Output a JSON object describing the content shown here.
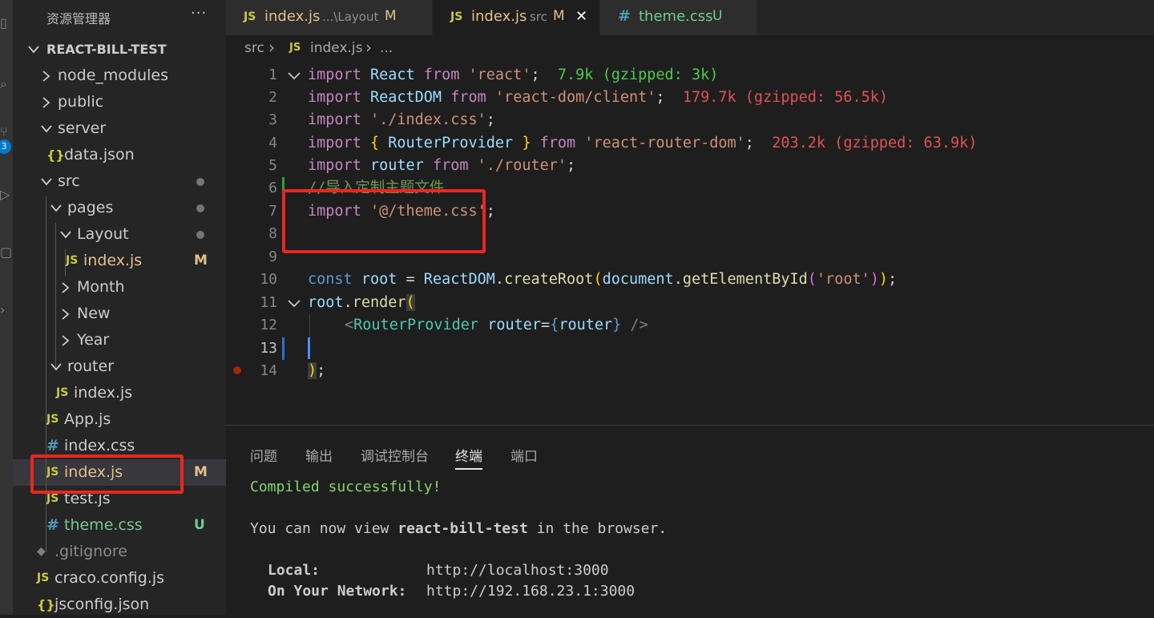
{
  "explorer": {
    "title": "资源管理器",
    "more": "···",
    "project": "REACT-BILL-TEST",
    "items": [
      {
        "label": "node_modules",
        "kind": "folder",
        "status": ""
      },
      {
        "label": "public",
        "kind": "folder",
        "status": ""
      },
      {
        "label": "server",
        "kind": "folder",
        "status": ""
      },
      {
        "label": "data.json",
        "kind": "json",
        "status": ""
      },
      {
        "label": "src",
        "kind": "folder",
        "status": "dot"
      },
      {
        "label": "pages",
        "kind": "folder",
        "status": "dot"
      },
      {
        "label": "Layout",
        "kind": "folder",
        "status": "dot"
      },
      {
        "label": "index.js",
        "kind": "js",
        "status": "M"
      },
      {
        "label": "Month",
        "kind": "folder",
        "status": ""
      },
      {
        "label": "New",
        "kind": "folder",
        "status": ""
      },
      {
        "label": "Year",
        "kind": "folder",
        "status": ""
      },
      {
        "label": "router",
        "kind": "folder",
        "status": ""
      },
      {
        "label": "index.js",
        "kind": "js",
        "status": ""
      },
      {
        "label": "App.js",
        "kind": "js",
        "status": ""
      },
      {
        "label": "index.css",
        "kind": "css",
        "status": ""
      },
      {
        "label": "index.js",
        "kind": "js",
        "status": "M"
      },
      {
        "label": "test.js",
        "kind": "js",
        "status": ""
      },
      {
        "label": "theme.css",
        "kind": "css",
        "status": "U"
      },
      {
        "label": ".gitignore",
        "kind": "git",
        "status": ""
      },
      {
        "label": "craco.config.js",
        "kind": "js",
        "status": ""
      },
      {
        "label": "jsconfig.json",
        "kind": "json",
        "status": ""
      }
    ]
  },
  "icons": {
    "js": "JS",
    "css": "#",
    "json": "{}",
    "git": "◆"
  },
  "activity": {
    "badge": "3"
  },
  "tabs": [
    {
      "icon": "JS",
      "name": "index.js",
      "desc": "...\\Layout",
      "status": "M"
    },
    {
      "icon": "JS",
      "name": "index.js",
      "desc": "src",
      "status": "M",
      "close": "✕"
    },
    {
      "icon": "#",
      "name": "theme.css",
      "desc": "",
      "status": "U"
    }
  ],
  "breadcrumb": {
    "part1": "src",
    "sep1": "›",
    "icon": "JS",
    "part2": "index.js",
    "sep2": "›",
    "part3": "..."
  },
  "editor": {
    "line_numbers": [
      "1",
      "2",
      "3",
      "4",
      "5",
      "6",
      "7",
      "8",
      "9",
      "10",
      "11",
      "12",
      "13",
      "14"
    ],
    "lines": [
      {
        "l1a": "import",
        "l1b": " React ",
        "l1c": "from",
        "l1d": " 'react'",
        "l1e": ";",
        "l1f": "  7.9k (gzipped: 3k)"
      },
      {
        "a": "import",
        "b": " ReactDOM ",
        "c": "from",
        "d": " 'react-dom/client'",
        "e": ";",
        "f": "  179.7k (gzipped: 56.5k)"
      },
      {
        "a": "import",
        "d": " './index.css'",
        "e": ";"
      },
      {
        "a": "import",
        "b1": " { ",
        "b2": "RouterProvider",
        "b3": " } ",
        "c": "from",
        "d": " 'react-router-dom'",
        "e": ";",
        "f": "  203.2k (gzipped: 63.9k)"
      },
      {
        "a": "import",
        "b": " router ",
        "c": "from",
        "d": " './router'",
        "e": ";"
      },
      {
        "comment": "//导入定制主题文件"
      },
      {
        "a": "import",
        "d": " '@/theme.css'",
        "e": ";"
      },
      {},
      {},
      {
        "a": "const",
        "b": " root ",
        "eq": "=",
        "c": " ReactDOM",
        "dot": ".",
        "fn": "createRoot",
        "p1": "(",
        "d": "document",
        "dot2": ".",
        "fn2": "getElementById",
        "p2": "(",
        "s": "'root'",
        "p3": ")",
        "p4": ")",
        "e": ";"
      },
      {
        "a": "root",
        "dot": ".",
        "fn": "render",
        "p1": "("
      },
      {
        "lt": "<",
        "tag": "RouterProvider",
        "attr": " router",
        "eq": "=",
        "b1": "{",
        "v": "router",
        "b2": "}",
        "close": " />"
      },
      {},
      {
        "p": ")",
        "e": ";"
      }
    ]
  },
  "panel": {
    "tabs": [
      "问题",
      "输出",
      "调试控制台",
      "终端",
      "端口"
    ],
    "active": "终端",
    "terminal": {
      "compiled": "Compiled successfully!",
      "view_pre": "You can now view ",
      "app": "react-bill-test",
      "view_post": " in the browser.",
      "local_label": "Local:",
      "local_url": "http://localhost:3000",
      "network_label": "On Your Network:",
      "network_url": "http://192.168.23.1:3000"
    }
  },
  "colors": {
    "highlight": "#e8271f",
    "modified": "#e2c08d",
    "untracked": "#73c991"
  }
}
